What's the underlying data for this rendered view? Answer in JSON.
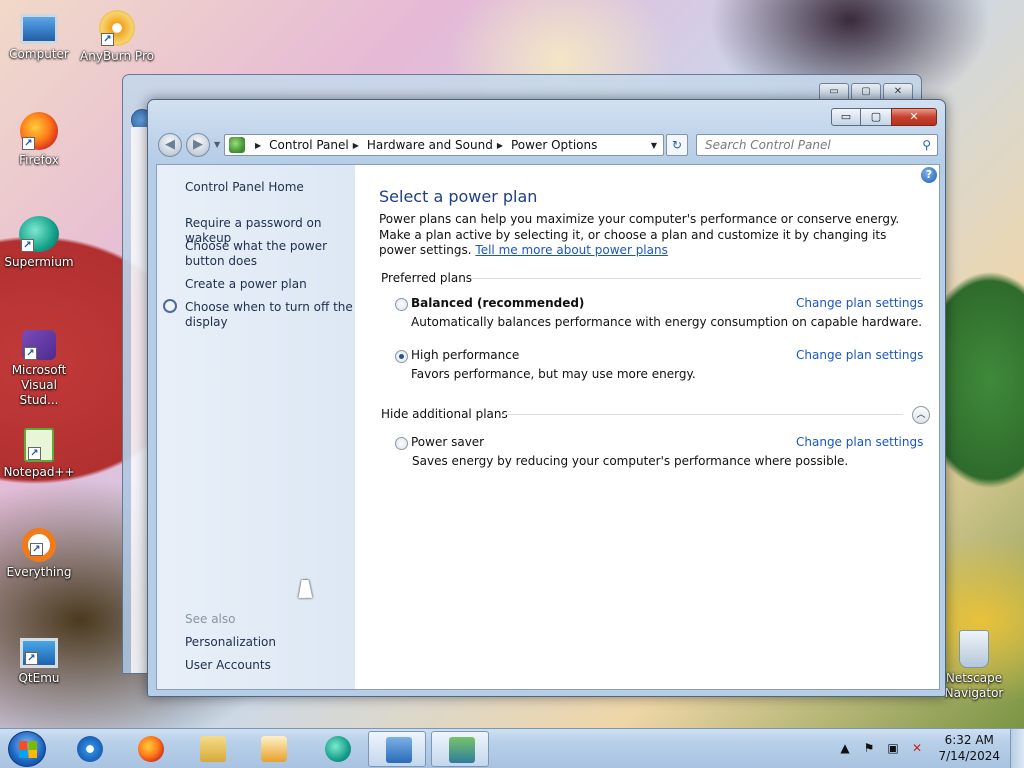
{
  "desktop": {
    "icons": [
      {
        "label": "Computer"
      },
      {
        "label": "AnyBurn Pro"
      },
      {
        "label": "Firefox"
      },
      {
        "label": "Supermium"
      },
      {
        "label": "Microsoft Visual Stud..."
      },
      {
        "label": "Notepad++"
      },
      {
        "label": "Everything"
      },
      {
        "label": "QtEmu"
      },
      {
        "label": "Netscape Navigator"
      }
    ]
  },
  "window": {
    "title_buttons": {
      "minimize": "▭",
      "maximize": "▢",
      "close": "✕"
    },
    "nav": {
      "back": "◀",
      "forward": "▶",
      "breadcrumbs": [
        "Control Panel",
        "Hardware and Sound",
        "Power Options"
      ],
      "search_placeholder": "Search Control Panel",
      "search_icon": "⚲",
      "refresh_icon": "↻"
    },
    "sidebar": {
      "home": "Control Panel Home",
      "links": [
        "Require a password on wakeup",
        "Choose what the power button does",
        "Create a power plan",
        "Choose when to turn off the display"
      ],
      "see_also_label": "See also",
      "see_also": [
        "Personalization",
        "User Accounts"
      ]
    },
    "main": {
      "title": "Select a power plan",
      "description": "Power plans can help you maximize your computer's performance or conserve energy. Make a plan active by selecting it, or choose a plan and customize it by changing its power settings.",
      "description_link": "Tell me more about power plans",
      "preferred_label": "Preferred plans",
      "hidden_label": "Hide additional plans",
      "help_icon": "?",
      "collapse_icon": "︿",
      "plans": [
        {
          "name": "Balanced (recommended)",
          "description": "Automatically balances performance with energy consumption on capable hardware.",
          "action": "Change plan settings",
          "selected": false
        },
        {
          "name": "High performance",
          "description": "Favors performance, but may use more energy.",
          "action": "Change plan settings",
          "selected": true
        },
        {
          "name": "Power saver",
          "description": "Saves energy by reducing your computer's performance where possible.",
          "action": "Change plan settings",
          "selected": false
        }
      ]
    }
  },
  "taskbar": {
    "items": [
      "internet-explorer",
      "firefox",
      "file-explorer",
      "media-player",
      "supermium",
      "control-panel",
      "remote-desktop"
    ],
    "tray": {
      "chevron": "▲",
      "flag": "⚑",
      "network": "▣",
      "volume": "✕"
    },
    "time": "6:32 AM",
    "date": "7/14/2024"
  },
  "colors": {
    "link": "#1a55c7",
    "title": "#1e3d8a",
    "taskbar": "#b9d1ea"
  }
}
